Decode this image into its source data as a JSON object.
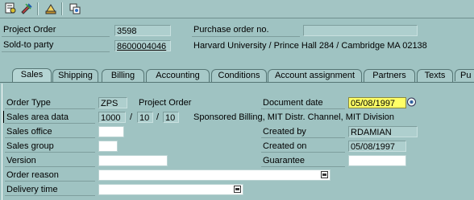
{
  "toolbar": {
    "icons": [
      "display-document-icon",
      "change-document-icon",
      "header-details-icon",
      "link-icon"
    ]
  },
  "header": {
    "project_order_label": "Project Order",
    "project_order_value": "3598",
    "purchase_order_label": "Purchase order no.",
    "purchase_order_value": "",
    "sold_to_label": "Sold-to party",
    "sold_to_value": "8600004046",
    "sold_to_description": "Harvard University / Prince Hall 284 / Cambridge MA 02138"
  },
  "tabs": [
    {
      "label": "Sales",
      "active": true
    },
    {
      "label": "Shipping",
      "active": false
    },
    {
      "label": "Billing",
      "active": false
    },
    {
      "label": "Accounting",
      "active": false
    },
    {
      "label": "Conditions",
      "active": false
    },
    {
      "label": "Account assignment",
      "active": false
    },
    {
      "label": "Partners",
      "active": false
    },
    {
      "label": "Texts",
      "active": false
    },
    {
      "label": "Pu",
      "active": false
    }
  ],
  "sales": {
    "order_type_label": "Order Type",
    "order_type_value": "ZPS",
    "order_type_desc": "Project Order",
    "document_date_label": "Document date",
    "document_date_value": "05/08/1997",
    "sales_area_label": "Sales area data",
    "sales_org": "1000",
    "distr_channel": "10",
    "division": "10",
    "slash": "/",
    "sales_area_desc": "Sponsored Billing, MIT Distr. Channel, MIT Division",
    "sales_office_label": "Sales office",
    "sales_office_value": "",
    "created_by_label": "Created by",
    "created_by_value": "RDAMIAN",
    "sales_group_label": "Sales group",
    "sales_group_value": "",
    "created_on_label": "Created on",
    "created_on_value": "05/08/1997",
    "version_label": "Version",
    "version_value": "",
    "guarantee_label": "Guarantee",
    "guarantee_value": "",
    "order_reason_label": "Order reason",
    "order_reason_value": "",
    "delivery_time_label": "Delivery time",
    "delivery_time_value": ""
  },
  "colors": {
    "background": "#9fc3c2",
    "required_field": "#ffff66",
    "tab_border": "#567675"
  }
}
